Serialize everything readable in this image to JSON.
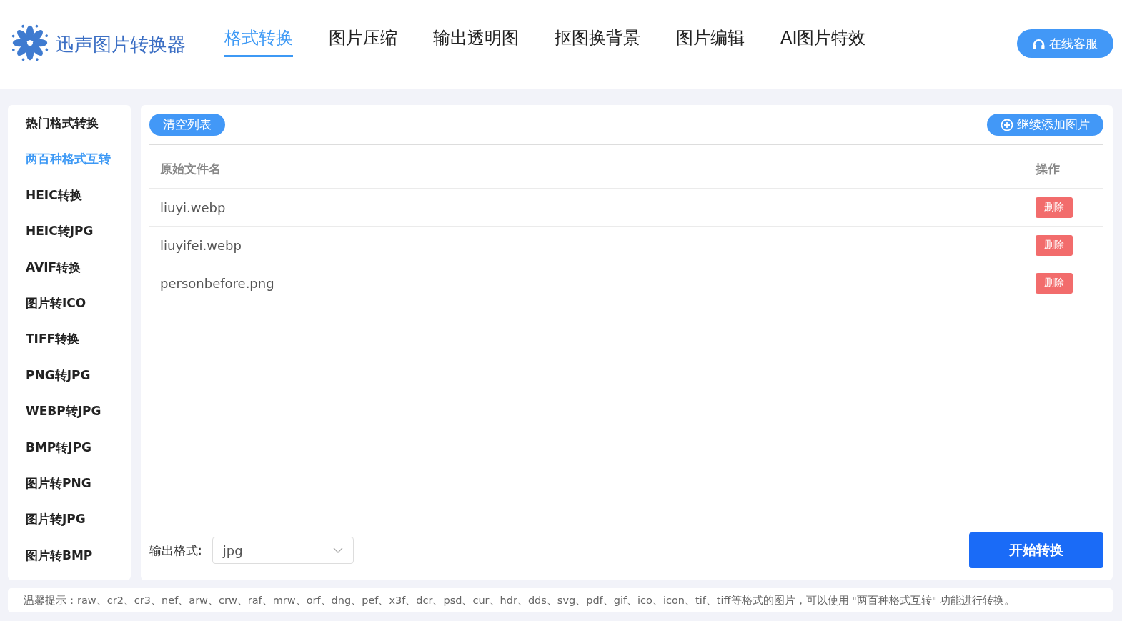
{
  "brand": {
    "name": "迅声图片转换器"
  },
  "nav": [
    {
      "label": "格式转换",
      "selected": true
    },
    {
      "label": "图片压缩",
      "selected": false
    },
    {
      "label": "输出透明图",
      "selected": false
    },
    {
      "label": "抠图换背景",
      "selected": false
    },
    {
      "label": "图片编辑",
      "selected": false
    },
    {
      "label": "AI图片特效",
      "selected": false
    }
  ],
  "support_button": "在线客服",
  "sidebar": {
    "items": [
      {
        "label": "热门格式转换",
        "selected": false
      },
      {
        "label": "两百种格式互转",
        "selected": true
      },
      {
        "label": "HEIC转换",
        "selected": false
      },
      {
        "label": "HEIC转JPG",
        "selected": false
      },
      {
        "label": "AVIF转换",
        "selected": false
      },
      {
        "label": "图片转ICO",
        "selected": false
      },
      {
        "label": "TIFF转换",
        "selected": false
      },
      {
        "label": "PNG转JPG",
        "selected": false
      },
      {
        "label": "WEBP转JPG",
        "selected": false
      },
      {
        "label": "BMP转JPG",
        "selected": false
      },
      {
        "label": "图片转PNG",
        "selected": false
      },
      {
        "label": "图片转JPG",
        "selected": false
      },
      {
        "label": "图片转BMP",
        "selected": false
      }
    ]
  },
  "toolbar": {
    "clear_button": "清空列表",
    "add_button": "继续添加图片"
  },
  "table": {
    "columns": [
      "原始文件名",
      "操作"
    ],
    "rows": [
      {
        "file": "liuyi.webp",
        "action": "删除"
      },
      {
        "file": "liuyifei.webp",
        "action": "删除"
      },
      {
        "file": "personbefore.png",
        "action": "删除"
      }
    ]
  },
  "output": {
    "label": "输出格式:",
    "value": "jpg"
  },
  "start_button": "开始转换",
  "tip": "温馨提示：raw、cr2、cr3、nef、arw、crw、raf、mrw、orf、dng、pef、x3f、dcr、psd、cur、hdr、dds、svg、pdf、gif、ico、icon、tif、tiff等格式的图片，可以使用 \"两百种格式互转\" 功能进行转换。"
}
